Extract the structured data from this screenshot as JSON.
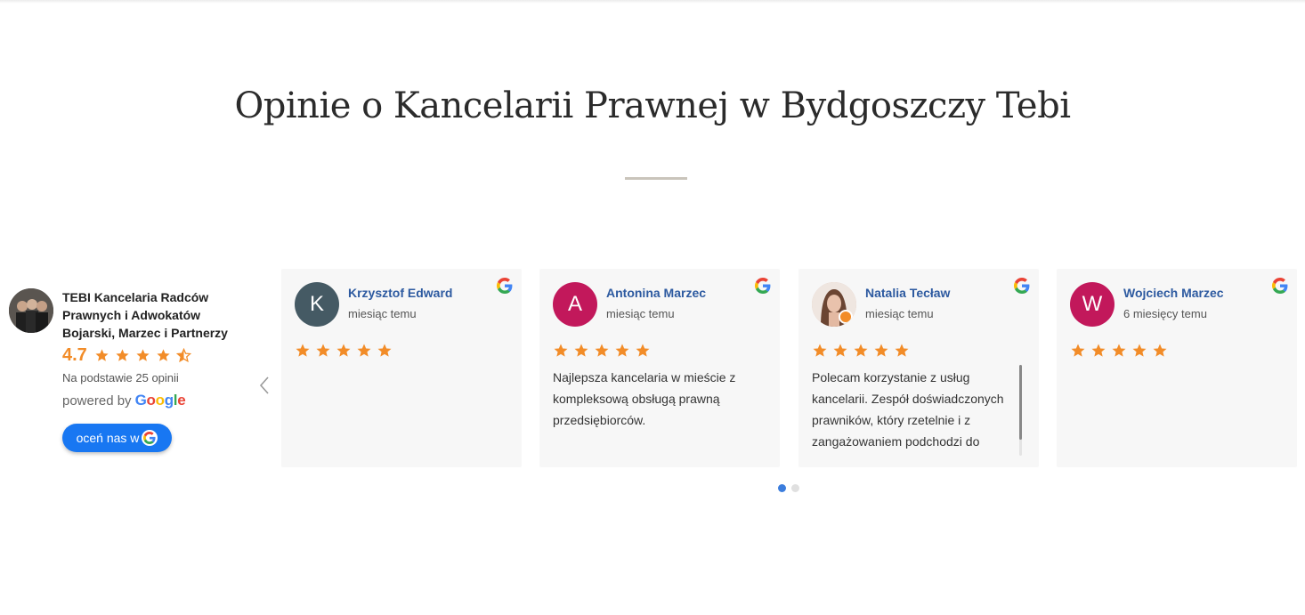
{
  "section": {
    "title": "Opinie o Kancelarii Prawnej w Bydgoszczy Tebi"
  },
  "summary": {
    "business_name": "TEBI Kancelaria Radców Prawnych i Adwokatów Bojarski, Marzec i Partnerzy",
    "rating": "4.7",
    "stars": 4.5,
    "based_on": "Na podstawie 25 opinii",
    "powered_by": "powered by",
    "google_word": "Google",
    "rate_button": "oceń nas w"
  },
  "reviews": [
    {
      "name": "Krzysztof Edward",
      "time": "miesiąc temu",
      "initial": "K",
      "avatar_color": "#455a64",
      "stars": 5,
      "text": ""
    },
    {
      "name": "Antonina Marzec",
      "time": "miesiąc temu",
      "initial": "A",
      "avatar_color": "#c2185b",
      "stars": 5,
      "text": "Najlepsza kancelaria w mieście z kompleksową obsługą prawną przedsiębiorców."
    },
    {
      "name": "Natalia Tecław",
      "time": "miesiąc temu",
      "initial": "",
      "avatar_color": "#d9b8a8",
      "stars": 5,
      "text": "Polecam korzystanie z usług kancelarii. Zespół doświadczonych prawników, który rzetelnie i z zangażowaniem podchodzi do"
    },
    {
      "name": "Wojciech Marzec",
      "time": "6 miesięcy temu",
      "initial": "W",
      "avatar_color": "#c2185b",
      "stars": 5,
      "text": ""
    }
  ],
  "pagination": {
    "pages": 2,
    "active": 1
  },
  "colors": {
    "star": "#f28c28",
    "accent": "#1877f2",
    "name_link": "#2d5aa0",
    "dot_active": "#3b7ddd",
    "dot_inactive": "#e0e0e0"
  },
  "icons": {
    "prev": "chevron-left-icon",
    "google": "google-g-icon",
    "star": "star-icon"
  }
}
